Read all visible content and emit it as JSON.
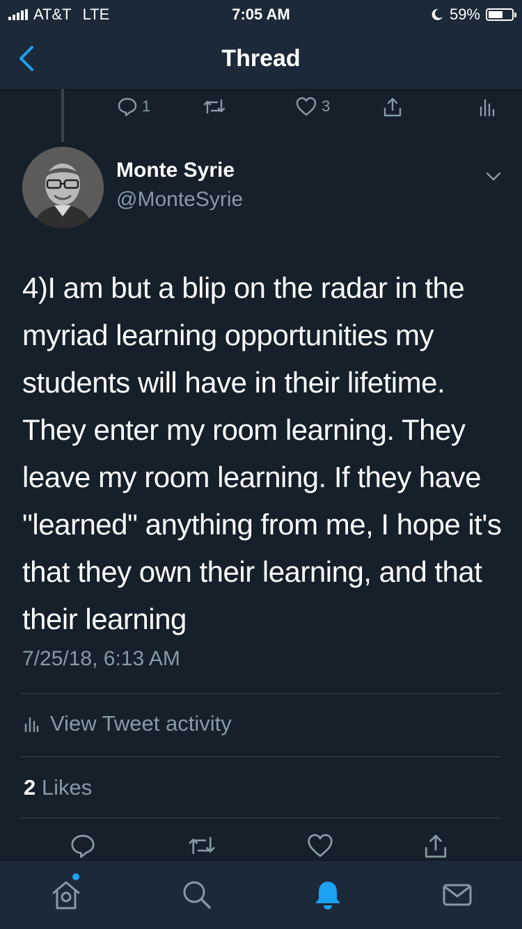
{
  "status_bar": {
    "carrier": "AT&T",
    "network": "LTE",
    "time": "7:05 AM",
    "battery": "59%",
    "battery_level": 0.59
  },
  "nav": {
    "title": "Thread",
    "back_icon": "chevron-left-icon"
  },
  "previous_tweet_actions": {
    "reply_count": "1",
    "retweet_count": "",
    "like_count": "3"
  },
  "tweet": {
    "author_name": "Monte Syrie",
    "author_handle": "@MonteSyrie",
    "text": "4)I am but a blip on the radar in the myriad learning opportunities my students will have in their lifetime. They enter my room learning. They leave my room learning. If they have \"learned\" anything from me, I hope it's that they own their learning, and that their learning",
    "timestamp": "7/25/18, 6:13 AM",
    "activity_label": "View Tweet activity",
    "likes_count": "2",
    "likes_label": "Likes"
  },
  "tab_bar": {
    "items": [
      "home-icon",
      "search-icon",
      "notifications-icon",
      "messages-icon"
    ],
    "active": "notifications-icon"
  },
  "colors": {
    "background": "#15202b",
    "bar": "#1c2938",
    "muted": "#8899a6",
    "accent": "#1da1f2",
    "divider": "#38444d"
  }
}
